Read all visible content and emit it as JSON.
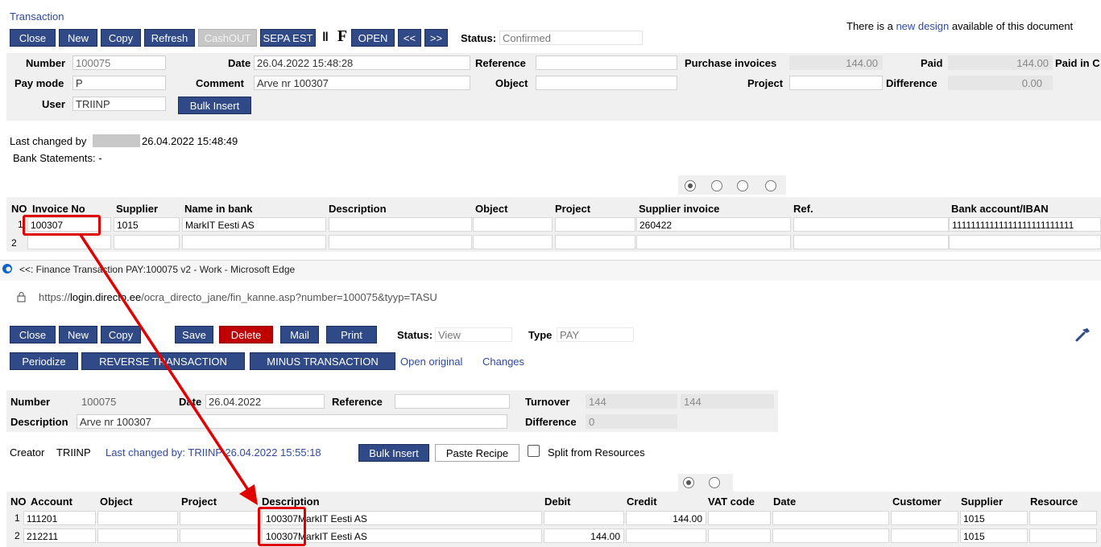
{
  "top": {
    "title": "Transaction",
    "notice_prefix": "There is a",
    "notice_link": "new design",
    "notice_suffix": "available of this document",
    "buttons": {
      "close": "Close",
      "new": "New",
      "copy": "Copy",
      "refresh": "Refresh",
      "cashout": "CashOUT",
      "sepa": "SEPA EST",
      "attach": "‖",
      "f": "F",
      "open": "OPEN",
      "prev": "<<",
      "next": ">>",
      "bulk_insert": "Bulk Insert"
    },
    "status_label": "Status:",
    "status_value": "Confirmed",
    "fields": {
      "number_label": "Number",
      "number": "100075",
      "date_label": "Date",
      "date": "26.04.2022 15:48:28",
      "reference_label": "Reference",
      "reference": "",
      "purchase_invoices_label": "Purchase invoices",
      "purchase_invoices": "144.00",
      "paid_label": "Paid",
      "paid": "144.00",
      "paid_in_label": "Paid in C",
      "paymode_label": "Pay mode",
      "paymode": "P",
      "comment_label": "Comment",
      "comment": "Arve nr 100307",
      "object_label": "Object",
      "object": "",
      "project_label": "Project",
      "project": "",
      "difference_label": "Difference",
      "difference": "0.00",
      "user_label": "User",
      "user": "TRIINP"
    },
    "last_changed_label": "Last changed by",
    "last_changed_time": "26.04.2022 15:48:49",
    "bank_statements": "Bank Statements: -",
    "table": {
      "headers": [
        "NO",
        "Invoice No",
        "Supplier",
        "Name in bank",
        "Description",
        "Object",
        "Project",
        "Supplier invoice",
        "Ref.",
        "Bank account/IBAN"
      ],
      "rows": [
        {
          "no": "1",
          "invoice": "100307",
          "supplier": "1015",
          "name": "MarkIT Eesti AS",
          "desc": "",
          "object": "",
          "project": "",
          "supinv": "260422",
          "ref": "",
          "iban": "11111111111111111111111111"
        },
        {
          "no": "2",
          "invoice": "",
          "supplier": "",
          "name": "",
          "desc": "",
          "object": "",
          "project": "",
          "supinv": "",
          "ref": "",
          "iban": ""
        }
      ]
    }
  },
  "browser": {
    "tab_title": "<<: Finance Transaction PAY:100075 v2 - Work - Microsoft Edge",
    "url_prefix": "https://",
    "url_host": "login.directo.ee",
    "url_path": "/ocra_directo_jane/fin_kanne.asp?number=100075&tyyp=TASU"
  },
  "bottom": {
    "buttons": {
      "close": "Close",
      "new": "New",
      "copy": "Copy",
      "save": "Save",
      "delete": "Delete",
      "mail": "Mail",
      "print": "Print",
      "periodize": "Periodize",
      "reverse": "REVERSE TRANSACTION",
      "minus": "MINUS TRANSACTION",
      "bulk_insert": "Bulk Insert",
      "paste_recipe": "Paste Recipe"
    },
    "status_label": "Status:",
    "status_value": "View",
    "type_label": "Type",
    "type_value": "PAY",
    "open_original": "Open original",
    "changes": "Changes",
    "fields": {
      "number_label": "Number",
      "number": "100075",
      "date_label": "Date",
      "date": "26.04.2022",
      "reference_label": "Reference",
      "reference": "",
      "turnover_label": "Turnover",
      "turnover1": "144",
      "turnover2": "144",
      "description_label": "Description",
      "description": "Arve nr 100307",
      "difference_label": "Difference",
      "difference": "0"
    },
    "creator_label": "Creator",
    "creator": "TRIINP",
    "last_changed": "Last changed by: TRIINP 26.04.2022 15:55:18",
    "split_label": "Split from Resources",
    "table": {
      "headers": [
        "NO",
        "Account",
        "Object",
        "Project",
        "Description",
        "Debit",
        "Credit",
        "VAT code",
        "Date",
        "Customer",
        "Supplier",
        "Resource"
      ],
      "rows": [
        {
          "no": "1",
          "account": "111201",
          "object": "",
          "project": "",
          "desc_num": "100307",
          "desc_text": "MarkIT Eesti AS",
          "debit": "",
          "credit": "144.00",
          "vat": "",
          "date": "",
          "customer": "",
          "supplier": "1015",
          "resource": ""
        },
        {
          "no": "2",
          "account": "212211",
          "object": "",
          "project": "",
          "desc_num": "100307",
          "desc_text": "MarkIT Eesti AS",
          "debit": "144.00",
          "credit": "",
          "vat": "",
          "date": "",
          "customer": "",
          "supplier": "1015",
          "resource": ""
        }
      ]
    }
  },
  "colors": {
    "button": "#2f4a86",
    "delete": "#c00000",
    "annotation": "#e00000",
    "link": "#2f4a9e"
  }
}
